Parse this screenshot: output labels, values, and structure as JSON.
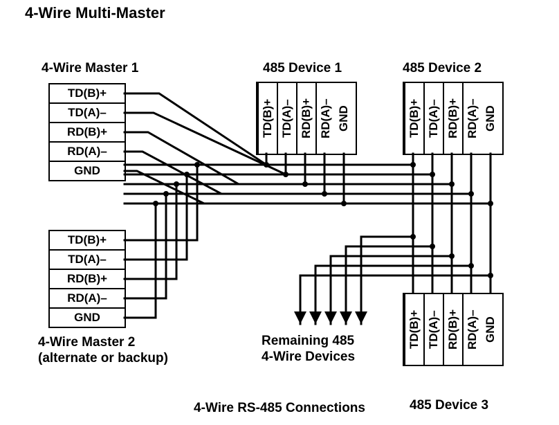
{
  "title": "4-Wire Multi-Master",
  "footer": "4-Wire RS-485 Connections",
  "remaining_line1": "Remaining 485",
  "remaining_line2": "4-Wire Devices",
  "master1": {
    "label": "4-Wire Master 1",
    "pins": [
      "TD(B)+",
      "TD(A)–",
      "RD(B)+",
      "RD(A)–",
      "GND"
    ]
  },
  "master2": {
    "label": "4-Wire Master 2",
    "sublabel": "(alternate or backup)",
    "pins": [
      "TD(B)+",
      "TD(A)–",
      "RD(B)+",
      "RD(A)–",
      "GND"
    ]
  },
  "device1": {
    "label": "485 Device 1",
    "pins": [
      "TD(B)+",
      "TD(A)–",
      "RD(B)+",
      "RD(A)–",
      "GND"
    ]
  },
  "device2": {
    "label": "485 Device 2",
    "pins": [
      "TD(B)+",
      "TD(A)–",
      "RD(B)+",
      "RD(A)–",
      "GND"
    ]
  },
  "device3": {
    "label": "485 Device 3",
    "pins": [
      "TD(B)+",
      "TD(A)–",
      "RD(B)+",
      "RD(A)–",
      "GND"
    ]
  }
}
